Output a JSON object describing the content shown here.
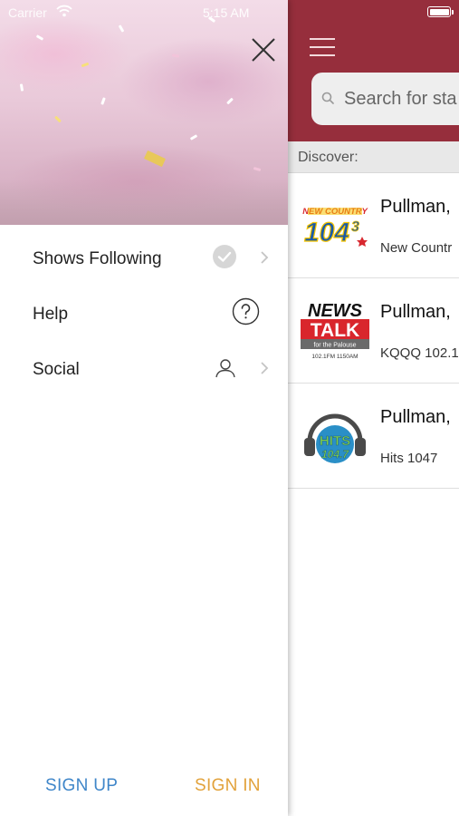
{
  "status_bar": {
    "carrier": "Carrier",
    "time": "5:15 AM"
  },
  "drawer": {
    "menu": [
      {
        "label": "Shows Following",
        "icon": "check-circle-icon"
      },
      {
        "label": "Help",
        "icon": "help-circle-icon"
      },
      {
        "label": "Social",
        "icon": "person-icon"
      }
    ],
    "sign_up_label": "SIGN UP",
    "sign_in_label": "SIGN IN"
  },
  "main": {
    "search_placeholder": "Search for sta",
    "discover_label": "Discover:",
    "stations": [
      {
        "city": "Pullman,",
        "description": "New Countr",
        "logo": "new-country-104-3-logo"
      },
      {
        "city": "Pullman,",
        "description": "KQQQ 102.1",
        "logo": "news-talk-logo"
      },
      {
        "city": "Pullman,",
        "description": "Hits 1047",
        "logo": "hits-104-7-logo"
      }
    ]
  },
  "colors": {
    "header": "#962e3c",
    "sign_up": "#3f86c9",
    "sign_in": "#e2a23b"
  },
  "logos": {
    "new_country_top": "NEW COUNTRY",
    "new_country_num": "104",
    "new_country_sup": "3",
    "news_talk_1": "NEWS",
    "news_talk_2": "TALK",
    "news_talk_3": "for the Palouse",
    "news_talk_4": "102.1FM 1150AM",
    "hits_1": "HITS",
    "hits_2": "104.7"
  }
}
